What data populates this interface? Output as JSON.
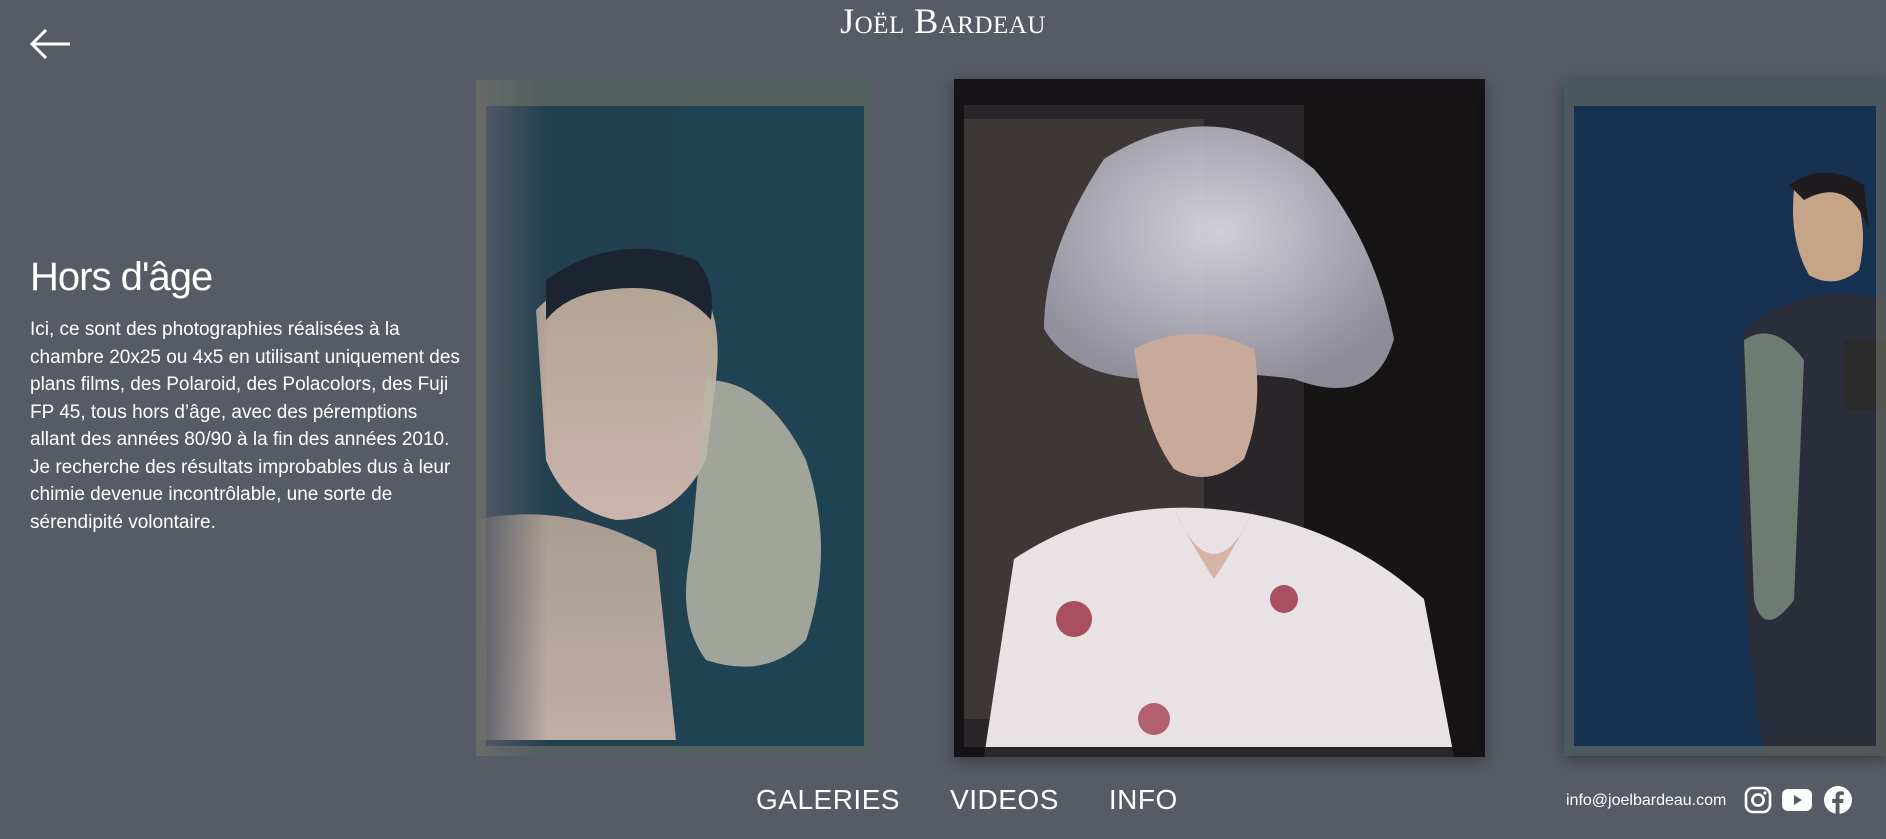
{
  "header": {
    "title": "Joël Bardeau",
    "back_icon": "arrow-left-icon"
  },
  "gallery": {
    "title": "Hors d'âge",
    "description": "Ici, ce sont des photographies réalisées à la chambre 20x25 ou 4x5 en utilisant uniquement des plans films, des Polaroid, des Polacolors, des Fuji FP 45, tous hors d’âge, avec des péremptions allant des années 80/90 à la fin des années 2010. Je recherche des résultats improbables dus à leur chimie devenue incontrôlable, une sorte de sérendipité volontaire."
  },
  "nav": {
    "items": [
      "GALERIES",
      "VIDEOS",
      "INFO"
    ]
  },
  "footer": {
    "email": "info@joelbardeau.com",
    "social_icons": [
      "instagram-icon",
      "youtube-icon",
      "facebook-icon"
    ]
  },
  "colors": {
    "background": "#575b66",
    "text": "#ffffff"
  }
}
